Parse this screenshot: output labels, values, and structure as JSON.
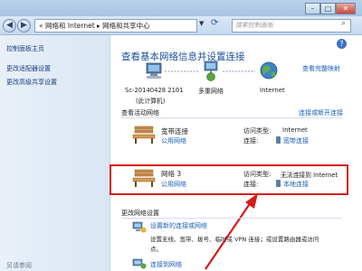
{
  "window": {
    "address": "« 网络和 Internet ▸ 网络和共享中心",
    "search_placeholder": "搜索控制面板",
    "help": "?"
  },
  "sidebar": {
    "items": [
      "控制面板主页",
      "更改适配器设置",
      "更改高级共享设置"
    ],
    "footer": "另请参阅"
  },
  "main": {
    "title": "查看基本网络信息并设置连接",
    "view_full_map": "查看完整映射",
    "map": {
      "computer": "Sc-20140428 2101",
      "computer_sub": "(此计算机)",
      "middle": "多重网络",
      "internet": "Internet"
    },
    "active_header": "查看活动网络",
    "connect_link": "连接或断开连接",
    "networks": [
      {
        "name": "宽带连接",
        "type": "公用网络",
        "access_label": "访问类型:",
        "access_value": "Internet",
        "conn_label": "连接:",
        "conn_value": "宽带连接"
      },
      {
        "name": "网络  3",
        "type": "公用网络",
        "access_label": "访问类型:",
        "access_value": "无法连接到 Internet",
        "conn_label": "连接:",
        "conn_value": "本地连接"
      }
    ],
    "change_header": "更改网络设置",
    "setup_link": "设置新的连接或网络",
    "setup_desc_1": "设置无线、宽带、拨号、临时或 VPN 连接；或设置路由器或访问",
    "setup_desc_2": "点。",
    "connect_network": "连接到网络"
  },
  "colors": {
    "highlight": "#d61a1a",
    "link": "#1a5fb4"
  }
}
